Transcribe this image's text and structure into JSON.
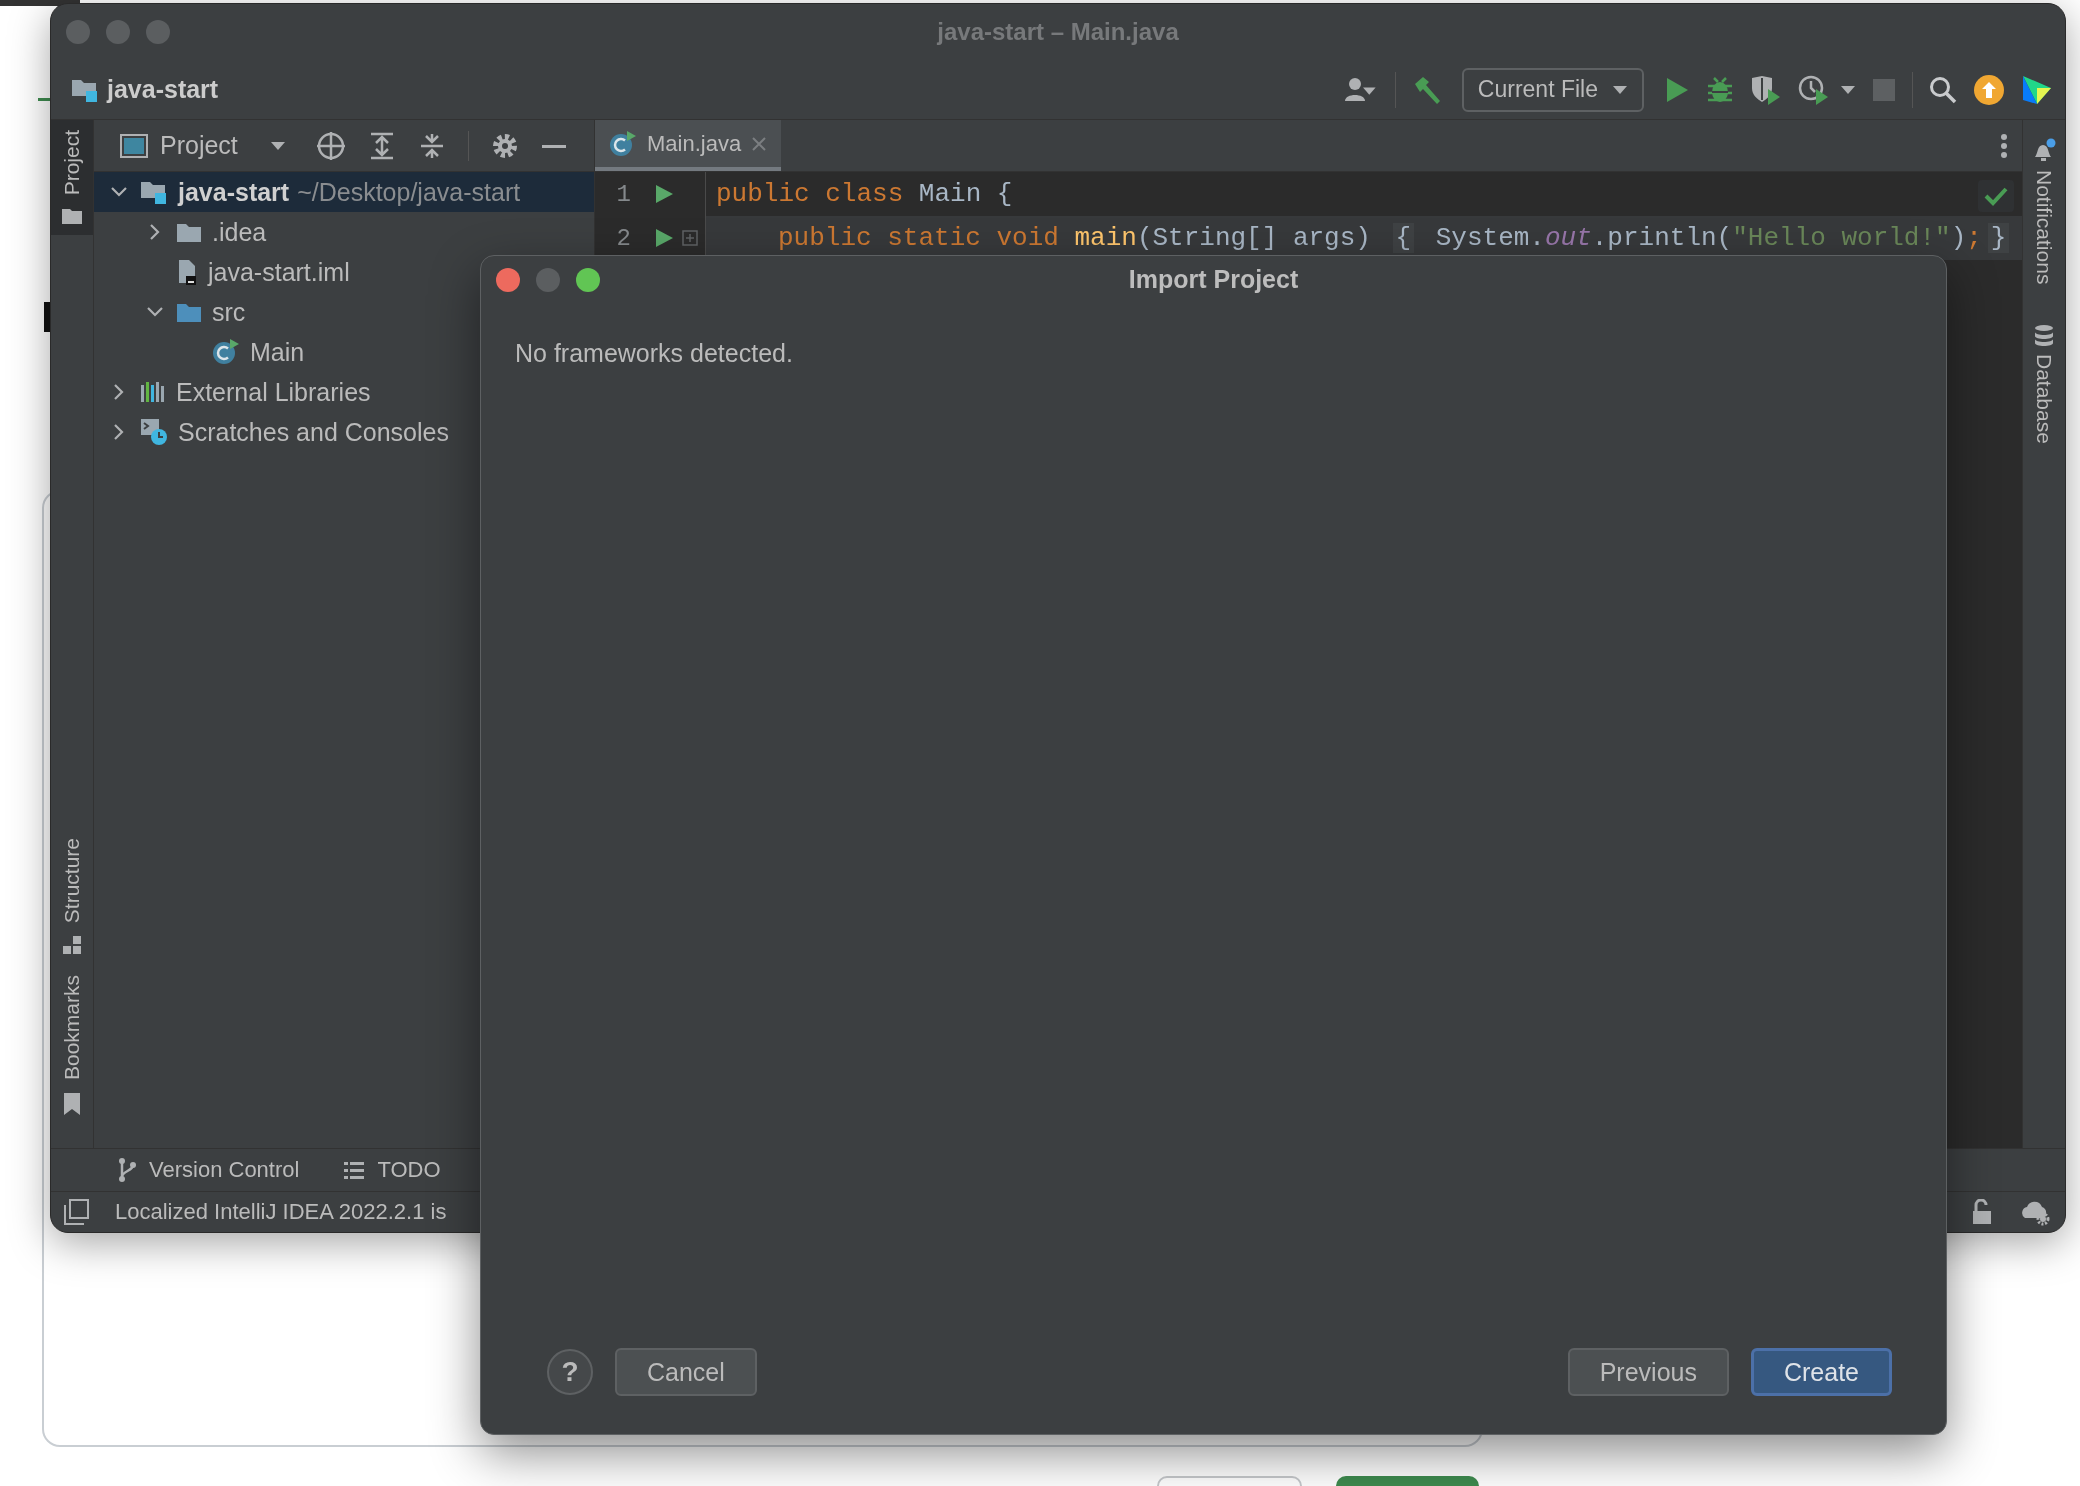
{
  "window": {
    "title": "java-start – Main.java",
    "active": false
  },
  "toolbar": {
    "project": "java-start",
    "run_config": "Current File"
  },
  "left_stripe": [
    {
      "kind": "project",
      "label": "Project",
      "selected": true
    },
    {
      "kind": "structure",
      "label": "Structure",
      "selected": false
    },
    {
      "kind": "bookmarks",
      "label": "Bookmarks",
      "selected": false
    }
  ],
  "project_panel": {
    "title": "Project",
    "tree": [
      {
        "kind": "module",
        "label": "java-start",
        "path": "~/Desktop/java-start",
        "selected": true,
        "expanded": true,
        "children": [
          {
            "kind": "folder",
            "label": ".idea",
            "selected": false,
            "expanded": false
          },
          {
            "kind": "file",
            "label": "java-start.iml",
            "selected": false
          },
          {
            "kind": "source",
            "label": "src",
            "selected": false,
            "expanded": true,
            "children": [
              {
                "kind": "class",
                "label": "Main",
                "selected": false
              }
            ]
          }
        ]
      },
      {
        "kind": "libraries",
        "label": "External Libraries",
        "selected": false,
        "expanded": false
      },
      {
        "kind": "scratches",
        "label": "Scratches and Consoles",
        "selected": false,
        "expanded": false
      }
    ]
  },
  "editor": {
    "tabs": [
      {
        "label": "Main.java",
        "selected": true
      }
    ],
    "lines": [
      {
        "number": "1",
        "runnable": true,
        "folded": false,
        "current": false,
        "tokens": [
          {
            "kind": "keyword",
            "text": "public class "
          },
          {
            "kind": "plain",
            "text": "Main {"
          }
        ],
        "children": [
          {
            "number": "2",
            "runnable": true,
            "folded": true,
            "current": true,
            "tokens": [
              {
                "kind": "keyword",
                "text": "public static void "
              },
              {
                "kind": "method",
                "text": "main"
              },
              {
                "kind": "plain",
                "text": "(String[] args) "
              },
              {
                "kind": "fold",
                "text": "{"
              },
              {
                "kind": "plain",
                "text": " System."
              },
              {
                "kind": "field",
                "text": "out"
              },
              {
                "kind": "plain",
                "text": ".println("
              },
              {
                "kind": "string",
                "text": "\"Hello world!\""
              },
              {
                "kind": "plain",
                "text": ")"
              },
              {
                "kind": "keyword",
                "text": ";"
              },
              {
                "kind": "fold",
                "text": "}"
              }
            ]
          }
        ]
      }
    ]
  },
  "right_stripe": [
    {
      "kind": "notifications",
      "label": "Notifications"
    },
    {
      "kind": "database",
      "label": "Database"
    }
  ],
  "bottom_tools": [
    {
      "kind": "vcs",
      "label": "Version Control"
    },
    {
      "kind": "todo",
      "label": "TODO"
    }
  ],
  "status_bar": {
    "message": "Localized IntelliJ IDEA 2022.2.1 is"
  },
  "dialog": {
    "title": "Import Project",
    "active": true,
    "message": "No frameworks detected.",
    "help": "?",
    "left_buttons": [
      {
        "label": "Cancel",
        "primary": false
      }
    ],
    "right_buttons": [
      {
        "label": "Previous",
        "primary": false
      },
      {
        "label": "Create",
        "primary": true
      }
    ]
  }
}
